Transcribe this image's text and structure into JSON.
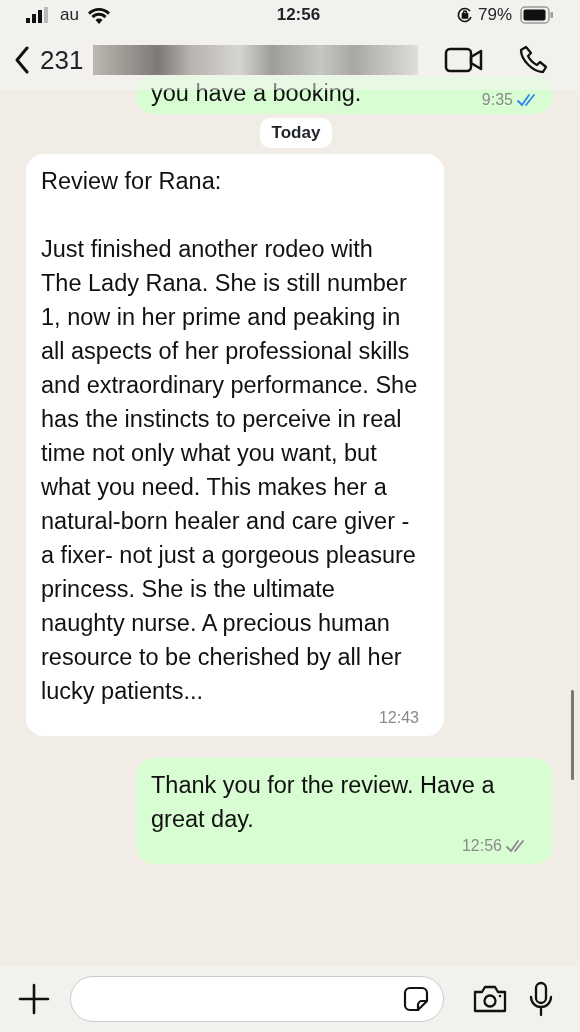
{
  "status_bar": {
    "carrier": "au",
    "time": "12:56",
    "battery": "79%"
  },
  "header": {
    "contact": "231"
  },
  "date_chip": "Today",
  "messages": [
    {
      "outgoing": true,
      "text": "you have a booking.",
      "time": "9:35",
      "read": true,
      "clipped": true
    },
    {
      "outgoing": false,
      "text": "Review for Rana:\n\nJust finished another rodeo with The Lady Rana. She is still number 1, now in her prime and peaking in all aspects of her professional skills and extraordinary performance. She has the instincts to perceive in real time not only what you want, but what you need. This makes her a natural-born healer and care giver -a fixer- not just a gorgeous pleasure princess. She is the ultimate naughty nurse. A precious human resource to be cherished by all her lucky patients...",
      "time": "12:43"
    },
    {
      "outgoing": true,
      "text": "Thank you for the review. Have a great day.",
      "time": "12:56",
      "read": false
    }
  ]
}
